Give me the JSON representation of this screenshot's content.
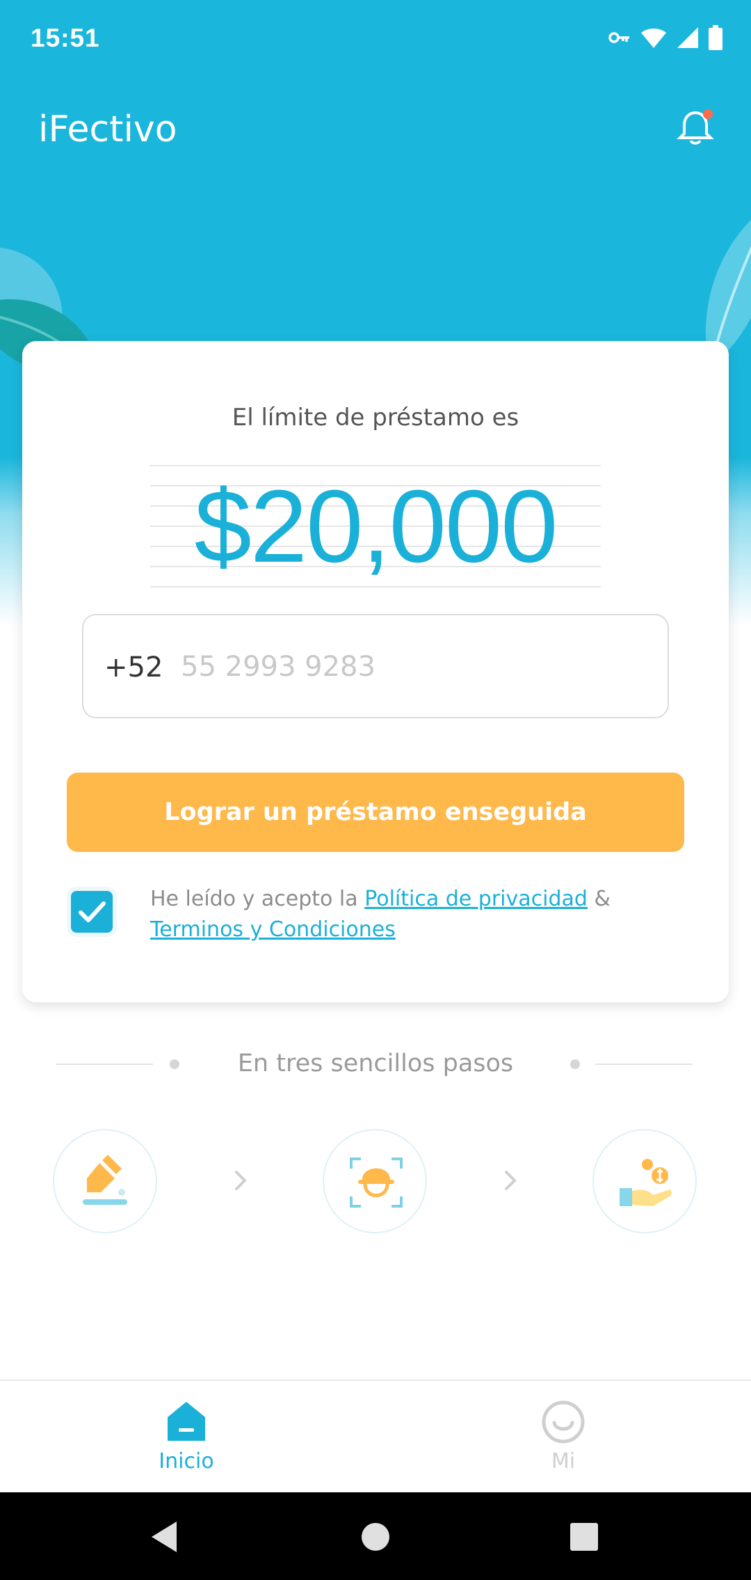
{
  "status_bar": {
    "time": "15:51",
    "icons": [
      "vpn-key-icon",
      "wifi-icon",
      "cell-signal-icon",
      "battery-icon"
    ]
  },
  "header": {
    "title": "iFectivo",
    "notification_icon": "bell-icon"
  },
  "card": {
    "limit_label": "El límite de préstamo es",
    "amount": "$20,000",
    "phone": {
      "prefix": "+52",
      "placeholder": "55 2993 9283",
      "value": ""
    },
    "cta_label": "Lograr un préstamo enseguida",
    "consent": {
      "checked": true,
      "text_before": "He leído y acepto la ",
      "privacy_link": "Política de privacidad",
      "separator": " & ",
      "terms_link": "Terminos y Condiciones"
    }
  },
  "steps": {
    "title": "En tres sencillos pasos",
    "items": [
      {
        "icon": "edit-form-icon"
      },
      {
        "icon": "face-scan-icon"
      },
      {
        "icon": "money-hand-icon"
      }
    ]
  },
  "bottom_nav": {
    "items": [
      {
        "label": "Inicio",
        "icon": "home-icon",
        "active": true
      },
      {
        "label": "Mi",
        "icon": "smiley-icon",
        "active": false
      }
    ]
  },
  "colors": {
    "primary": "#1bb6dc",
    "accent": "#ffb84a",
    "inactive": "#cfcfcf"
  }
}
